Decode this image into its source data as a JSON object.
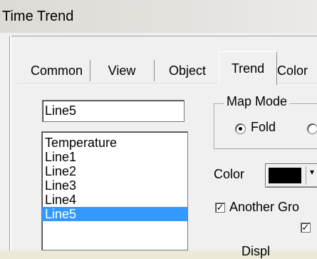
{
  "window": {
    "title": "Time Trend"
  },
  "tabs": [
    {
      "label": "Common"
    },
    {
      "label": "View"
    },
    {
      "label": "Object"
    },
    {
      "label": "Trend",
      "active": true
    },
    {
      "label": "Color"
    }
  ],
  "trend": {
    "name_value": "Line5",
    "lines": [
      "Temperature",
      "Line1",
      "Line2",
      "Line3",
      "Line4",
      "Line5"
    ],
    "selected_line": "Line5",
    "map_mode": {
      "label": "Map Mode",
      "options": [
        "Fold",
        ""
      ],
      "selected": "Fold"
    },
    "color": {
      "label": "Color",
      "value": "#000000"
    },
    "another_group": {
      "label": "Another Gro",
      "checked": true
    },
    "second_checkbox": {
      "checked": true
    },
    "bottom_partial_text": "Displ"
  },
  "colors": {
    "selection": "#3399ff",
    "dialog_bg": "#f0f0f0"
  }
}
